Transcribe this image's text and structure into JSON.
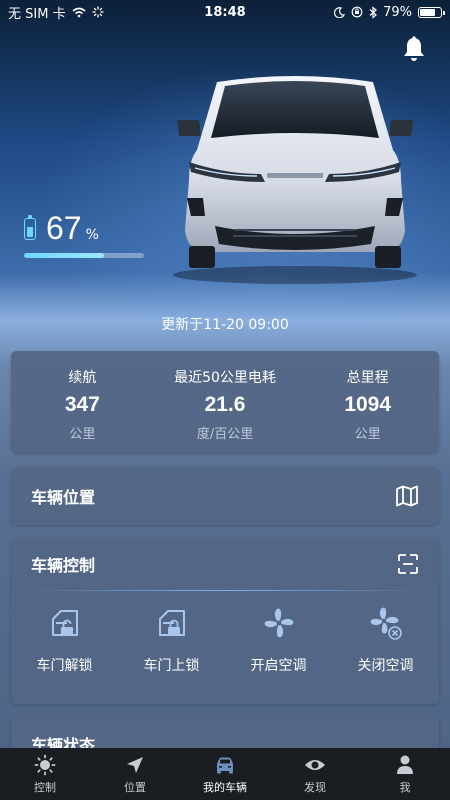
{
  "status_bar": {
    "carrier": "无 SIM 卡",
    "time": "18:48",
    "battery_percent": "79%",
    "battery_level": 0.79
  },
  "vehicle": {
    "soc_value": "67",
    "soc_unit": "%",
    "soc_level": 0.67,
    "update_time": "更新于11-20 09:00"
  },
  "stats": [
    {
      "label": "续航",
      "value": "347",
      "unit": "公里"
    },
    {
      "label": "最近50公里电耗",
      "value": "21.6",
      "unit": "度/百公里"
    },
    {
      "label": "总里程",
      "value": "1094",
      "unit": "公里"
    }
  ],
  "location": {
    "title": "车辆位置",
    "icon": "map-icon"
  },
  "control": {
    "title": "车辆控制",
    "icon": "scan-icon",
    "actions": [
      {
        "label": "车门解锁",
        "icon": "door-unlock-icon"
      },
      {
        "label": "车门上锁",
        "icon": "door-lock-icon"
      },
      {
        "label": "开启空调",
        "icon": "fan-on-icon"
      },
      {
        "label": "关闭空调",
        "icon": "fan-off-icon"
      }
    ]
  },
  "status_section": {
    "title": "车辆状态"
  },
  "tabs": [
    {
      "label": "控制",
      "icon": "sun-icon"
    },
    {
      "label": "位置",
      "icon": "navigation-arrow-icon"
    },
    {
      "label": "我的车辆",
      "icon": "car-icon",
      "active": true
    },
    {
      "label": "发现",
      "icon": "eye-icon"
    },
    {
      "label": "我",
      "icon": "person-icon"
    }
  ],
  "colors": {
    "accent": "#6fd7ff",
    "card": "#546684",
    "tab_bar": "#1a1d22"
  }
}
